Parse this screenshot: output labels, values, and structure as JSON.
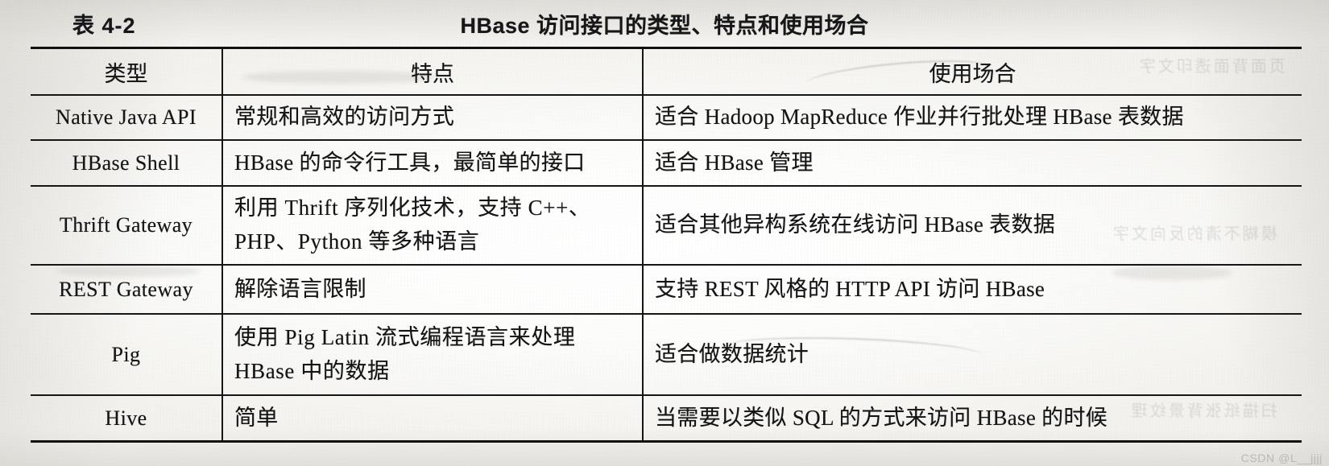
{
  "caption": {
    "number": "表 4-2",
    "title": "HBase 访问接口的类型、特点和使用场合"
  },
  "table": {
    "headers": [
      "类型",
      "特点",
      "使用场合"
    ],
    "rows": [
      {
        "type": "Native Java API",
        "feature_lines": [
          "常规和高效的访问方式"
        ],
        "usecase_lines": [
          "适合 Hadoop MapReduce 作业并行批处理 HBase 表数据"
        ]
      },
      {
        "type": "HBase Shell",
        "feature_lines": [
          "HBase 的命令行工具，最简单的接口"
        ],
        "usecase_lines": [
          "适合 HBase 管理"
        ]
      },
      {
        "type": "Thrift Gateway",
        "feature_lines": [
          "利用 Thrift 序列化技术，支持 C++、",
          "PHP、Python 等多种语言"
        ],
        "usecase_lines": [
          "适合其他异构系统在线访问 HBase 表数据"
        ]
      },
      {
        "type": "REST Gateway",
        "feature_lines": [
          "解除语言限制"
        ],
        "usecase_lines": [
          "支持 REST 风格的 HTTP API 访问 HBase"
        ]
      },
      {
        "type": "Pig",
        "feature_lines": [
          "使用 Pig Latin 流式编程语言来处理",
          "HBase 中的数据"
        ],
        "usecase_lines": [
          "适合做数据统计"
        ]
      },
      {
        "type": "Hive",
        "feature_lines": [
          "简单"
        ],
        "usecase_lines": [
          "当需要以类似 SQL 的方式来访问 HBase 的时候"
        ]
      }
    ]
  },
  "watermark": {
    "text": "CSDN @L__jjjj"
  },
  "bleedthrough": {
    "line1": "页面背面透印文字",
    "line2": "模糊不清的反向文字",
    "line3": "扫描纸张背景纹理"
  },
  "colors": {
    "ink": "#141414",
    "rule": "#161616",
    "paper": "#fdfdfc",
    "watermark": "#b9b8b4"
  }
}
